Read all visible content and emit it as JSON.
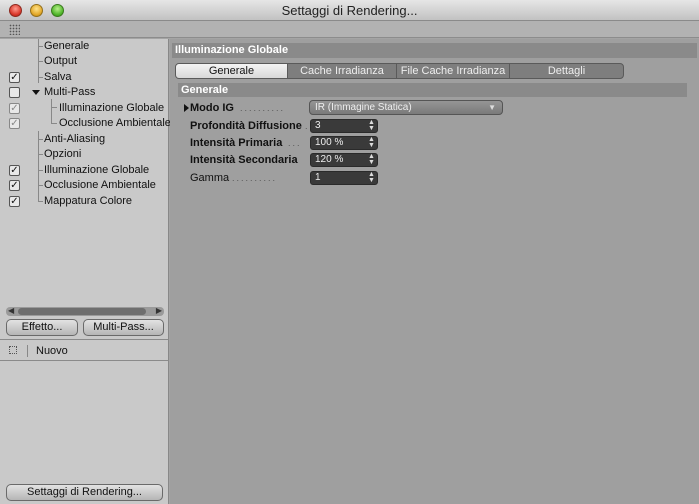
{
  "window": {
    "title": "Settaggi di Rendering..."
  },
  "tree": {
    "items": [
      {
        "label": "Generale",
        "check": ""
      },
      {
        "label": "Output",
        "check": ""
      },
      {
        "label": "Salva",
        "check": "on"
      },
      {
        "label": "Multi-Pass",
        "check": "empty"
      },
      {
        "label": "Illuminazione Globale",
        "check": "dim"
      },
      {
        "label": "Occlusione Ambientale",
        "check": "dim"
      },
      {
        "label": "Anti-Aliasing",
        "check": ""
      },
      {
        "label": "Opzioni",
        "check": ""
      },
      {
        "label": "Illuminazione Globale",
        "check": "on"
      },
      {
        "label": "Occlusione Ambientale",
        "check": "on"
      },
      {
        "label": "Mappatura Colore",
        "check": "on"
      }
    ]
  },
  "buttons": {
    "effetto": "Effetto...",
    "multipass": "Multi-Pass...",
    "settaggi": "Settaggi di Rendering..."
  },
  "preset": {
    "new_label": "Nuovo"
  },
  "panel": {
    "title": "Illuminazione Globale",
    "tabs": [
      "Generale",
      "Cache Irradianza",
      "File Cache Irradianza",
      "Dettagli"
    ],
    "active_tab": "Generale",
    "group": "Generale",
    "properties": [
      {
        "label": "Modo IG",
        "value": "IR (Immagine Statica)"
      },
      {
        "label": "Profondità Diffusione",
        "value": "3"
      },
      {
        "label": "Intensità Primaria",
        "value": "100 %"
      },
      {
        "label": "Intensità Secondaria",
        "value": "120 %"
      },
      {
        "label": "Gamma",
        "value": "1"
      }
    ]
  },
  "icons": {
    "checkmark": "check-icon",
    "expand": "triangle-right-icon",
    "collapse": "triangle-down-icon",
    "grip": "grip-icon",
    "dropdown": "chevron-down-icon",
    "stepper": "stepper-icon"
  }
}
